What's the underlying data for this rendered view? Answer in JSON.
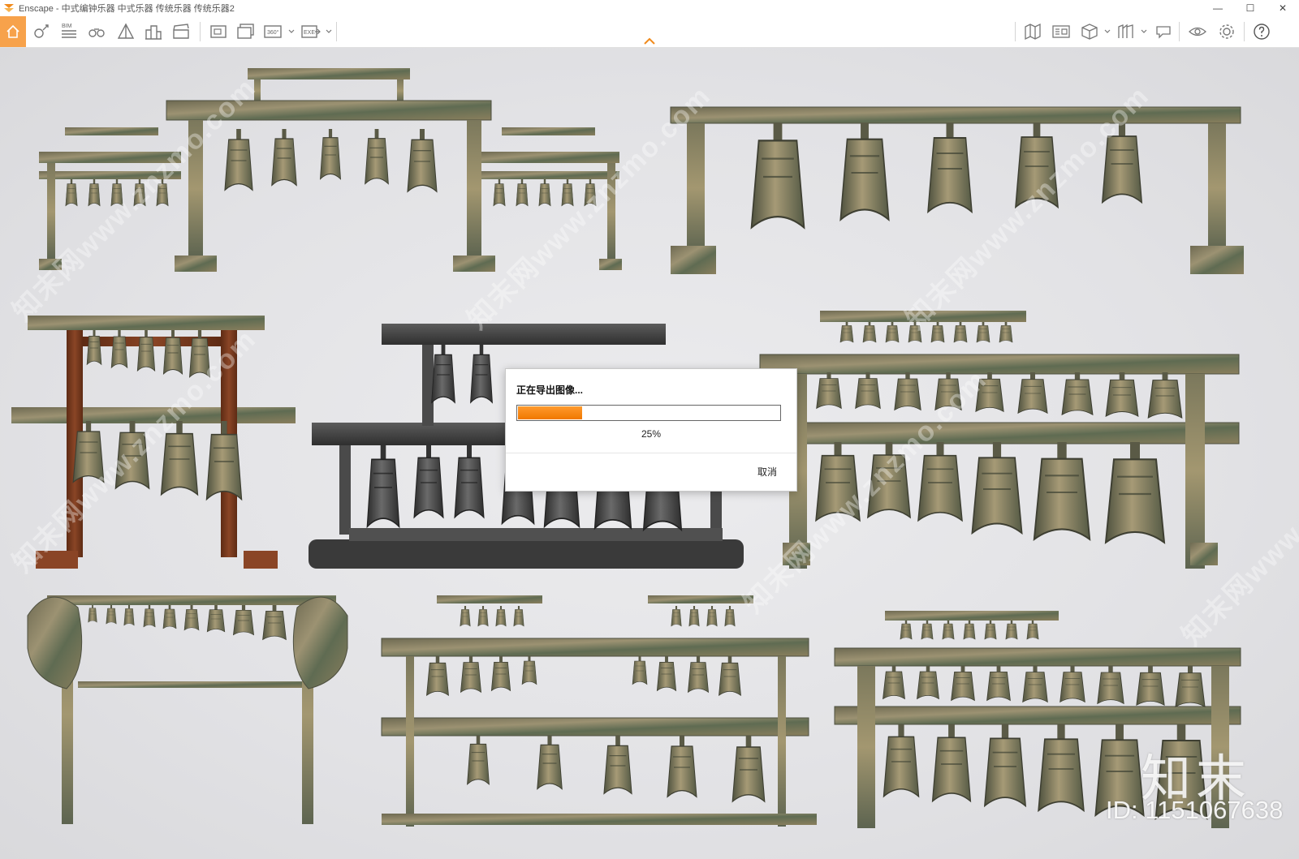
{
  "window": {
    "app_name": "Enscape",
    "title": "Enscape - 中式编钟乐器 中式乐器 传统乐器 传统乐器2",
    "controls": {
      "minimize": "—",
      "maximize": "☐",
      "close": "✕"
    }
  },
  "toolbar": {
    "left_icons": [
      "home-icon",
      "location-icon",
      "bim-icon",
      "binoculars-icon",
      "sketch-icon",
      "buildings-icon",
      "clapperboard-icon",
      "screenshot-icon",
      "batch-render-icon",
      "panorama-360-icon",
      "export-exe-icon"
    ],
    "right_icons": [
      "map-icon",
      "asset-library-icon",
      "cube-view-icon",
      "material-icon",
      "feedback-icon",
      "visual-settings-icon",
      "settings-icon",
      "help-icon"
    ],
    "bim_label": "BIM",
    "pano_label": "360°",
    "exe_label": "EXE",
    "accent": "#f7a24b"
  },
  "dialog": {
    "title": "正在导出图像...",
    "progress": 0.25,
    "progress_label": "25%",
    "cancel_label": "取消"
  },
  "watermarks": {
    "diagonal": [
      "知末网www.znzmo.com",
      "知末网www.znzmo.com",
      "知末网www.znzmo.com",
      "知末网www.znzmo.com",
      "知末网www.znzmo.com",
      "知末网www.znzmo.com"
    ],
    "brand": "知末",
    "id_text": "ID: 1151067638"
  },
  "colors": {
    "bronze_dark": "#5a5a46",
    "bronze_light": "#9a8f6a",
    "patina": "#7b8a6a",
    "wood": "#7a3a1e",
    "iron": "#3e3e3e"
  }
}
